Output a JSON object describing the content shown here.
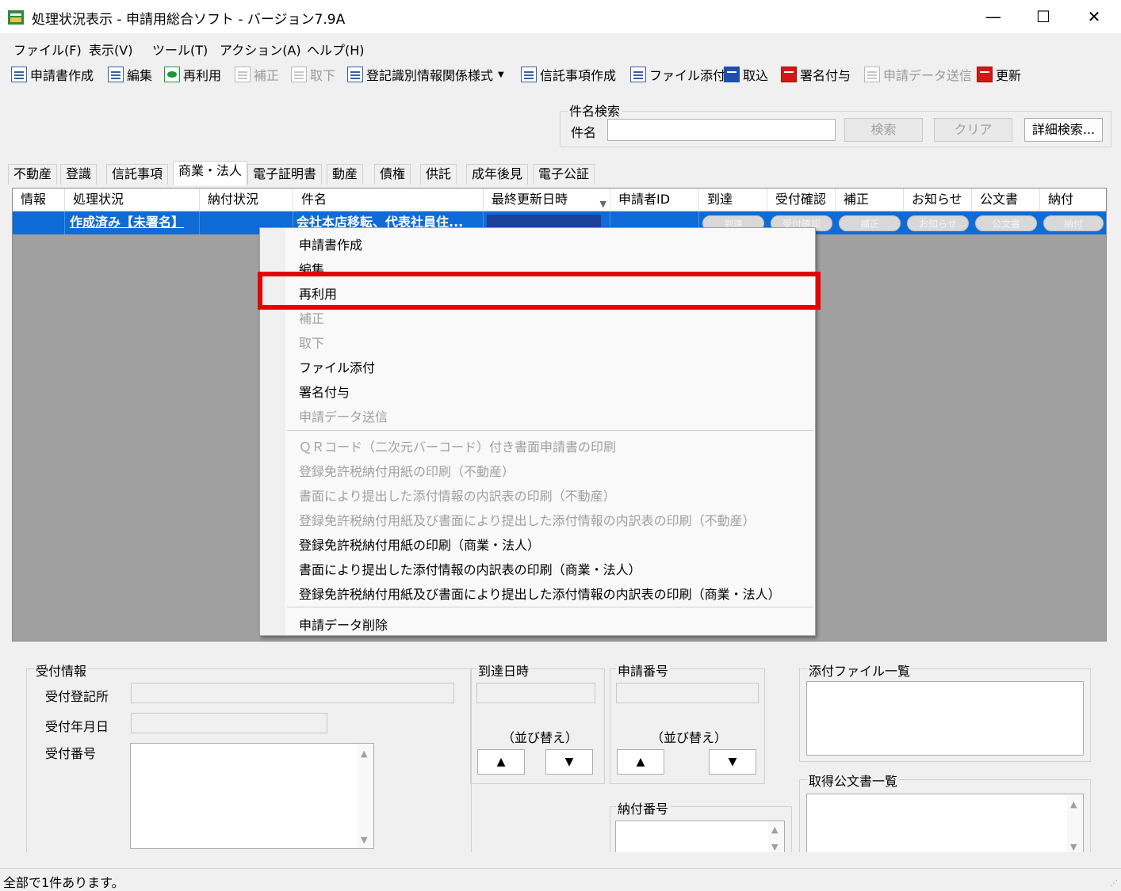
{
  "window": {
    "title": "処理状況表示 - 申請用総合ソフト - バージョン7.9A",
    "minimize": "—",
    "maximize": "☐",
    "close": "✕"
  },
  "menubar": [
    "ファイル(F)",
    "表示(V)",
    "ツール(T)",
    "アクション(A)",
    "ヘルプ(H)"
  ],
  "toolbar": [
    {
      "label": "申請書作成",
      "enabled": true
    },
    {
      "label": "編集",
      "enabled": true
    },
    {
      "label": "再利用",
      "enabled": true
    },
    {
      "label": "補正",
      "enabled": false
    },
    {
      "label": "取下",
      "enabled": false
    },
    {
      "label": "登記識別情報関係様式",
      "enabled": true
    },
    {
      "label": "信託事項作成",
      "enabled": true
    },
    {
      "label": "ファイル添付",
      "enabled": true
    },
    {
      "label": "取込",
      "enabled": true
    },
    {
      "label": "署名付与",
      "enabled": true
    },
    {
      "label": "申請データ送信",
      "enabled": false
    },
    {
      "label": "更新",
      "enabled": true
    }
  ],
  "search": {
    "group_title": "件名検索",
    "label": "件名",
    "value": "",
    "search_button": "検索",
    "clear_button": "クリア",
    "detail_button": "詳細検索..."
  },
  "tabs": [
    "不動産",
    "登識",
    "信託事項",
    "商業・法人",
    "電子証明書",
    "動産",
    "債権",
    "供託",
    "成年後見",
    "電子公証"
  ],
  "active_tab": "商業・法人",
  "grid": {
    "headers": [
      "情報",
      "処理状況",
      "納付状況",
      "件名",
      "最終更新日時",
      "申請者ID",
      "到達",
      "受付確認",
      "補正",
      "お知らせ",
      "公文書",
      "納付"
    ],
    "row": {
      "info": "",
      "status": "作成済み【未署名】",
      "payment": "",
      "subject": "会社本店移転、代表社員住...",
      "updated": "",
      "applicant": "",
      "buttons": [
        "到達",
        "受付確認",
        "補正",
        "お知らせ",
        "公文書",
        "納付"
      ]
    }
  },
  "context_menu": {
    "items": [
      {
        "label": "申請書作成",
        "enabled": true
      },
      {
        "label": "編集",
        "enabled": true
      },
      {
        "label": "再利用",
        "enabled": true,
        "highlighted": true
      },
      {
        "label": "補正",
        "enabled": false
      },
      {
        "label": "取下",
        "enabled": false
      },
      {
        "label": "ファイル添付",
        "enabled": true
      },
      {
        "label": "署名付与",
        "enabled": true
      },
      {
        "label": "申請データ送信",
        "enabled": false
      },
      {
        "label": "ＱＲコード（二次元バーコード）付き書面申請書の印刷",
        "enabled": false
      },
      {
        "label": "登録免許税納付用紙の印刷（不動産）",
        "enabled": false
      },
      {
        "label": "書面により提出した添付情報の内訳表の印刷（不動産）",
        "enabled": false
      },
      {
        "label": "登録免許税納付用紙及び書面により提出した添付情報の内訳表の印刷（不動産）",
        "enabled": false
      },
      {
        "label": "登録免許税納付用紙の印刷（商業・法人）",
        "enabled": true
      },
      {
        "label": "書面により提出した添付情報の内訳表の印刷（商業・法人）",
        "enabled": true
      },
      {
        "label": "登録免許税納付用紙及び書面により提出した添付情報の内訳表の印刷（商業・法人）",
        "enabled": true
      },
      {
        "label": "申請データ削除",
        "enabled": true
      }
    ]
  },
  "details": {
    "receipt_group": "受付情報",
    "receipt_office": "受付登記所",
    "receipt_date": "受付年月日",
    "receipt_number": "受付番号",
    "arrival_group": "到達日時",
    "arrival_sort": "（並び替え）",
    "application_group": "申請番号",
    "application_sort": "（並び替え）",
    "payment_group": "納付番号",
    "sort_up": "▲",
    "sort_down": "▼",
    "attachments_group": "添付ファイル一覧",
    "official_docs_group": "取得公文書一覧"
  },
  "status_bar": "全部で1件あります。",
  "colors": {
    "selection": "#0f6cd6",
    "highlight_box": "#e60000"
  }
}
